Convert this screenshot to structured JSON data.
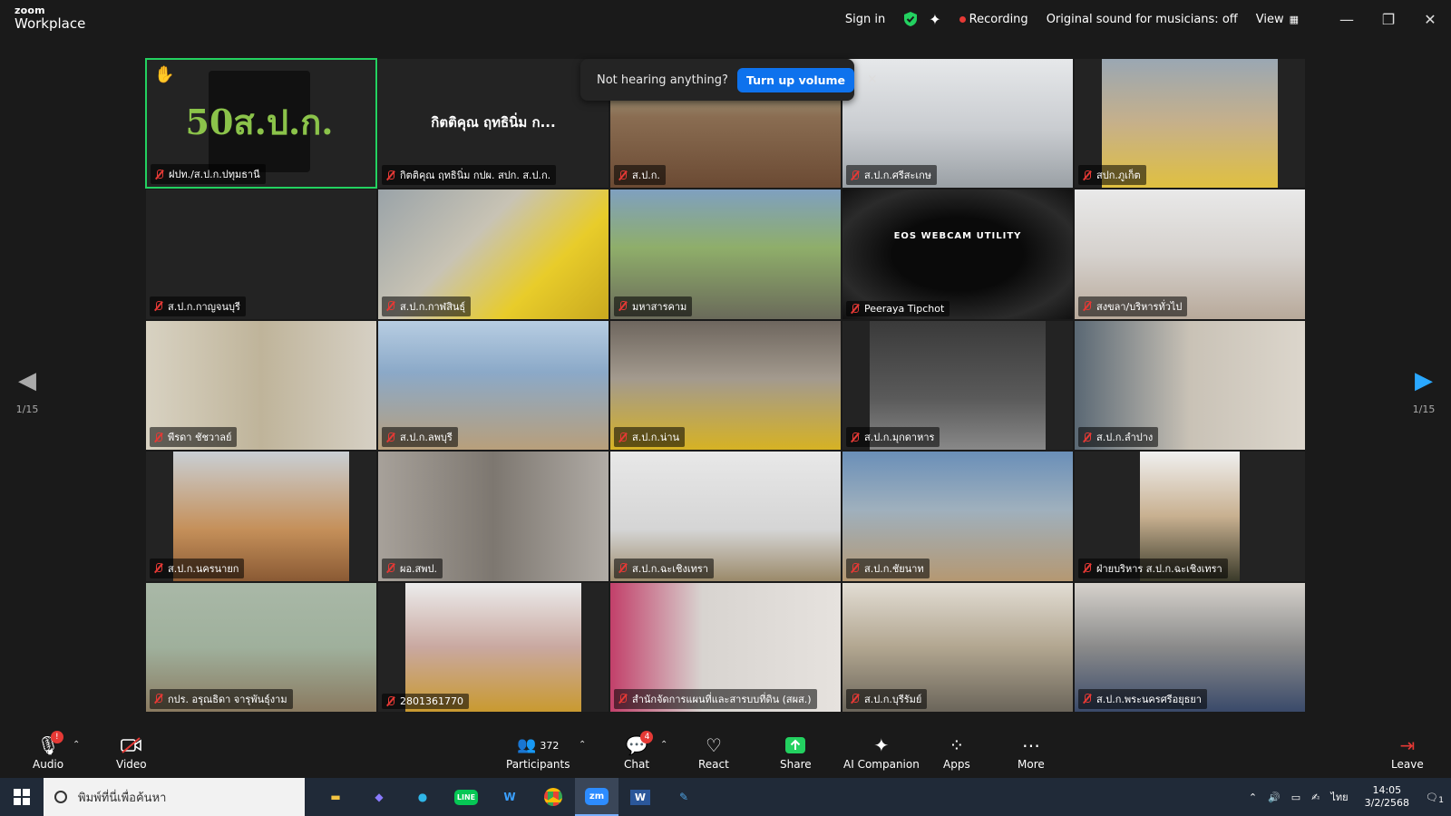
{
  "app": {
    "logo_top": "zoom",
    "logo_bottom": "Workplace"
  },
  "topbar": {
    "sign_in": "Sign in",
    "recording": "Recording",
    "original_sound": "Original sound for musicians: off",
    "view": "View"
  },
  "toast": {
    "text": "Not hearing anything?",
    "button": "Turn up volume"
  },
  "pager": {
    "left": "1/15",
    "right": "1/15"
  },
  "tiles": [
    {
      "label": "ฝปท./ส.ป.ก.ปทุมธานี",
      "logo_text": "50ส.ป.ก."
    },
    {
      "label": "กิตติคุณ ฤทธินิ่ม กปผ. สปก. ส.ป.ก.",
      "center": "กิตติคุณ ฤทธินิ่ม ก..."
    },
    {
      "label": "ส.ป.ก."
    },
    {
      "label": "ส.ป.ก.ศรีสะเกษ"
    },
    {
      "label": "สปก.ภูเก็ต"
    },
    {
      "label": "ส.ป.ก.กาญจนบุรี"
    },
    {
      "label": "ส.ป.ก.กาฬสินธุ์"
    },
    {
      "label": "มหาสารคาม"
    },
    {
      "label": "Peeraya Tipchot",
      "center": "EOS WEBCAM UTILITY"
    },
    {
      "label": "สงขลา/บริหารทั่วไป"
    },
    {
      "label": "พีรดา ชัชวาลย์"
    },
    {
      "label": "ส.ป.ก.ลพบุรี"
    },
    {
      "label": "ส.ป.ก.น่าน"
    },
    {
      "label": "ส.ป.ก.มุกดาหาร"
    },
    {
      "label": "ส.ป.ก.ลำปาง"
    },
    {
      "label": "ส.ป.ก.นครนายก"
    },
    {
      "label": "ผอ.สพป."
    },
    {
      "label": "ส.ป.ก.ฉะเชิงเทรา"
    },
    {
      "label": "ส.ป.ก.ชัยนาท"
    },
    {
      "label": "ฝ่ายบริหาร ส.ป.ก.ฉะเชิงเทรา"
    },
    {
      "label": "กปร. อรุณธิดา จารุพันธุ์งาม"
    },
    {
      "label": "2801361770"
    },
    {
      "label": "สำนักจัดการแผนที่และสารบบที่ดิน (สผส.)"
    },
    {
      "label": "ส.ป.ก.บุรีรัมย์"
    },
    {
      "label": "ส.ป.ก.พระนครศรีอยุธยา"
    }
  ],
  "toolbar": {
    "audio": "Audio",
    "video": "Video",
    "participants": "Participants",
    "participants_count": "372",
    "chat": "Chat",
    "chat_badge": "4",
    "react": "React",
    "share": "Share",
    "ai_companion": "AI Companion",
    "apps": "Apps",
    "more": "More",
    "leave": "Leave"
  },
  "taskbar": {
    "search_placeholder": "พิมพ์ที่นี่เพื่อค้นหา",
    "lang": "ไทย",
    "time": "14:05",
    "date": "3/2/2568",
    "notif_count": "1"
  },
  "colors": {
    "accent": "#0e72ed",
    "active_border": "#23d160",
    "muted_red": "#e53935"
  }
}
